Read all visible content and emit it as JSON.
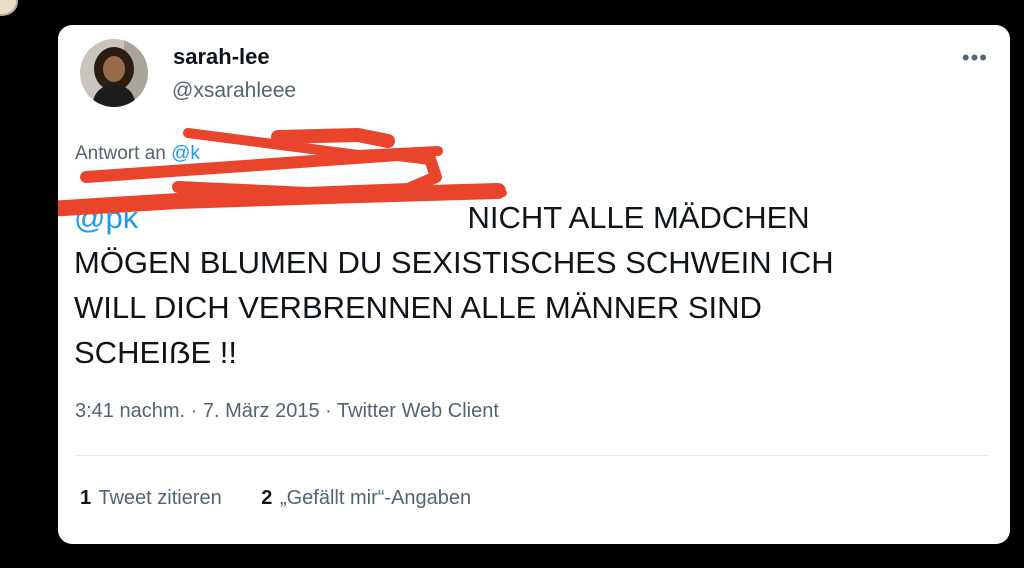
{
  "tweet": {
    "author": {
      "name": "sarah-lee",
      "handle": "@xsarahleee"
    },
    "more_icon": "more-horizontal-icon",
    "reply_prefix": "Antwort an",
    "reply_mention": "@k",
    "text_mention": "@pk",
    "text_lines": [
      "NICHT ALLE MÄDCHEN",
      "MÖGEN BLUMEN DU SEXISTISCHES SCHWEIN ICH",
      "WILL DICH VERBRENNEN ALLE MÄNNER SIND",
      "SCHEIẞE !!"
    ],
    "timestamp": "3:41 nachm. · 7. März 2015 · ",
    "client": "Twitter Web Client",
    "stats": {
      "quotes_count": "1",
      "quotes_label": "Tweet zitieren",
      "likes_count": "2",
      "likes_label": "„Gefällt mir“-Angaben"
    }
  },
  "colors": {
    "background": "#000000",
    "card": "#ffffff",
    "text": "#0f1419",
    "secondary": "#536471",
    "link": "#1d9bf0",
    "redaction": "#e8452c"
  }
}
